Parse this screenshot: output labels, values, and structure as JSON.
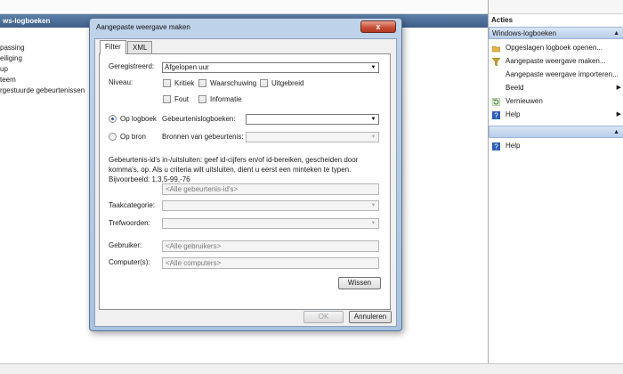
{
  "tree": {
    "header": "ws-logboeken",
    "items": [
      "passing",
      "eiliging",
      "up",
      "teem",
      "rgestuurde gebeurtenissen"
    ]
  },
  "actions": {
    "title": "Acties",
    "section1": "Windows-logboeken",
    "items": [
      {
        "label": "Opgeslagen logboek openen...",
        "icon": "folder-icon"
      },
      {
        "label": "Aangepaste weergave maken...",
        "icon": "filter-icon"
      },
      {
        "label": "Aangepaste weergave importeren...",
        "icon": ""
      },
      {
        "label": "Beeld",
        "icon": ""
      },
      {
        "label": "Vernieuwen",
        "icon": "refresh-icon"
      },
      {
        "label": "Help",
        "icon": "help-icon"
      }
    ],
    "section2_items": [
      {
        "label": "Help",
        "icon": "help-icon"
      }
    ]
  },
  "dialog": {
    "title": "Aangepaste weergave maken",
    "close": "x",
    "tabs": [
      "Filter",
      "XML"
    ],
    "filter": {
      "logged_label": "Geregistreerd:",
      "logged_value": "Afgelopen uur",
      "level_label": "Niveau:",
      "levels": [
        "Kritiek",
        "Waarschuwing",
        "Uitgebreid",
        "Fout",
        "Informatie"
      ],
      "by_log_label": "Op logboek",
      "event_logs_label": "Gebeurtenislogboeken:",
      "by_source_label": "Op bron",
      "event_sources_label": "Bronnen van gebeurtenis:",
      "event_ids_desc": "Gebeurtenis-id's in-/uitsluiten: geef id-cijfers en/of id-bereiken, gescheiden door komma's, op. Als u criteria wilt uitsluiten, dient u eerst een minteken te typen. Bijvoorbeeld: 1,3,5-99,-76",
      "event_ids_placeholder": "<Alle gebeurtenis-id's>",
      "task_category_label": "Taakcategorie:",
      "keywords_label": "Trefwoorden:",
      "user_label": "Gebruiker:",
      "user_placeholder": "<Alle gebruikers>",
      "computer_label": "Computer(s):",
      "computer_placeholder": "<Alle computers>",
      "clear_button": "Wissen"
    },
    "ok_button": "OK",
    "cancel_button": "Annuleren"
  }
}
